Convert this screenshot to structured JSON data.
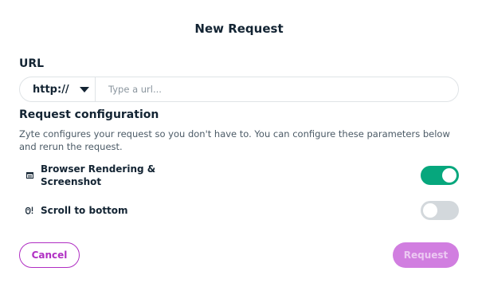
{
  "dialog": {
    "title": "New Request"
  },
  "url": {
    "label": "URL",
    "protocol": "http://",
    "placeholder": "Type a url..."
  },
  "config": {
    "title": "Request configuration",
    "description": "Zyte configures your request so you don't have to. You can configure these parameters below and rerun the request.",
    "options": [
      {
        "label": "Browser Rendering & Screenshot",
        "icon": "browser-window-icon",
        "enabled": true
      },
      {
        "label": "Scroll to bottom",
        "icon": "scroll-mouse-icon",
        "enabled": false
      }
    ]
  },
  "actions": {
    "cancel_label": "Cancel",
    "request_label": "Request"
  },
  "colors": {
    "accent": "#b02fc3",
    "toggle_on": "#06a77d",
    "toggle_off": "#d3d8dc",
    "request_disabled": "#d17ee0"
  }
}
